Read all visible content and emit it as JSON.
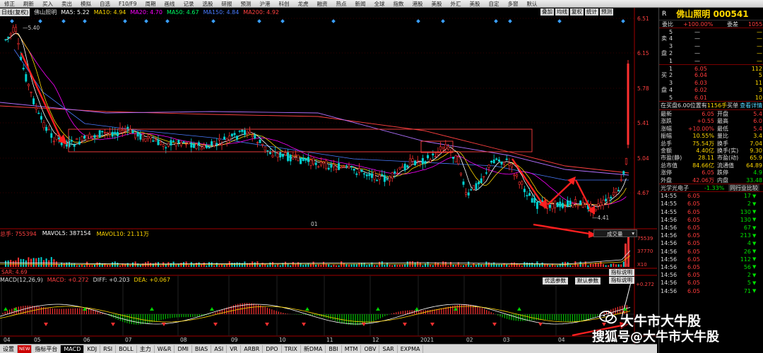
{
  "toolbar": [
    "修正",
    "刷新",
    "买入",
    "卖出",
    "模拟",
    "自选",
    "F10/F9",
    "周期",
    "画线",
    "记录",
    "选股",
    "研报",
    "预测",
    "沪港",
    "科创",
    "龙虎",
    "融资",
    "热点",
    "新闻",
    "全球",
    "指数",
    "港股",
    "美股",
    "外汇",
    "美股",
    "自定",
    "多窗",
    "默认"
  ],
  "legend": {
    "period": "日线(复权)",
    "stock": "佛山照明",
    "ma5": "MA5: 5.22",
    "ma10": "MA10: 4.94",
    "ma20": "MA20: 4.70",
    "ma50": "MA50: 4.67",
    "ma150": "MA150: 4.84",
    "ma200": "MA200: 4.92"
  },
  "chart_controls": [
    "叠加",
    "均线",
    "复权",
    "统计",
    "预测"
  ],
  "price_axis": [
    "6.51",
    "6.15",
    "5.78",
    "5.41",
    "5.04",
    "4.67"
  ],
  "annotations": {
    "high": "5.40",
    "low": "4.41",
    "marker": "01"
  },
  "volume": {
    "total": "总手: 755394",
    "mavol5": "MAVOL5: 387154",
    "mavol10": "MAVOL10: 21.11万",
    "dropdown": "成交量",
    "axis": [
      "75539",
      "37770",
      "X10"
    ]
  },
  "sar": "SAR: 4.69",
  "macd": {
    "title": "MACD(12,26,9)",
    "macd": "MACD: +0.272",
    "diff": "DIFF: +0.203",
    "dea": "DEA: +0.067",
    "axis": "+0.272",
    "btn_opt": "优选参数",
    "btn_default": "默认参数",
    "btn_help": "指标说明",
    "btn_help2": "指标说明"
  },
  "x_labels": [
    "04",
    "05",
    "06",
    "07",
    "08",
    "09",
    "10",
    "11",
    "12",
    "2021",
    "02",
    "03",
    "04"
  ],
  "bottom_tabs": [
    "设置",
    "NEW",
    "指标平台",
    "MACD",
    "KDJ",
    "RSI",
    "BOLL",
    "主力",
    "W&R",
    "DMI",
    "BIAS",
    "ASI",
    "VR",
    "ARBR",
    "DPO",
    "TRIX",
    "新DMA",
    "BBI",
    "MTM",
    "OBV",
    "SAR",
    "EXPMA"
  ],
  "right": {
    "r": "R",
    "name": "佛山照明",
    "code": "000541",
    "weibi_label": "委比",
    "weibi": "+100.00%",
    "weicha": "1055",
    "sell_label": [
      "卖",
      "盘"
    ],
    "buy_label": [
      "买",
      "盘"
    ],
    "sell": [
      [
        "5",
        "—",
        "—"
      ],
      [
        "4",
        "—",
        "—"
      ],
      [
        "3",
        "—",
        "—"
      ],
      [
        "2",
        "—",
        "—"
      ],
      [
        "1",
        "—",
        "—"
      ]
    ],
    "buy": [
      [
        "1",
        "6.05",
        "112"
      ],
      [
        "2",
        "6.04",
        "5"
      ],
      [
        "3",
        "6.03",
        "11"
      ],
      [
        "4",
        "6.02",
        "3"
      ],
      [
        "5",
        "6.01",
        "10"
      ]
    ],
    "zaimai": "在买盘6.00位置有",
    "zaimai2": "1156手",
    "zaimai3": "买单",
    "zaimai4": "查看详情",
    "stats": [
      [
        "最新",
        "6.05",
        "开盘",
        "5.4"
      ],
      [
        "涨跌",
        "+0.55",
        "最高",
        "6.0"
      ],
      [
        "涨幅",
        "+10.00%",
        "最低",
        "5.4"
      ],
      [
        "振幅",
        "10.55%",
        "量比",
        "3.4"
      ],
      [
        "总手",
        "75.54万",
        "换手",
        "7.04"
      ],
      [
        "金额",
        "4.40亿",
        "换手(实)",
        "9.30"
      ],
      [
        "市盈(静)",
        "28.11",
        "市盈(动)",
        "65.9"
      ],
      [
        "总市值",
        "84.66亿",
        "流通值",
        "64.89"
      ],
      [
        "涨停",
        "6.05",
        "跌停",
        "4.9"
      ],
      [
        "外盘",
        "42.06万",
        "内盘",
        "33.48"
      ]
    ],
    "sector": "光学光电子",
    "sector_change": "-1.33%",
    "sector_btn": "同行业比较",
    "ticks": [
      [
        "14:55",
        "6.05",
        "17"
      ],
      [
        "14:55",
        "6.05",
        "2"
      ],
      [
        "14:55",
        "6.05",
        "130"
      ],
      [
        "14:56",
        "6.05",
        "130"
      ],
      [
        "14:56",
        "6.05",
        "67"
      ],
      [
        "14:56",
        "6.05",
        "213"
      ],
      [
        "14:56",
        "6.05",
        "4"
      ],
      [
        "14:56",
        "6.05",
        "26"
      ],
      [
        "14:56",
        "6.05",
        "112"
      ],
      [
        "14:56",
        "6.05",
        "56"
      ],
      [
        "14:56",
        "6.05",
        "2"
      ],
      [
        "14:56",
        "6.05",
        "5"
      ],
      [
        "14:56",
        "6.05",
        "71"
      ]
    ]
  },
  "watermark": {
    "line1": "大牛市大牛股",
    "line2": "搜狐号@大牛市大牛股"
  }
}
